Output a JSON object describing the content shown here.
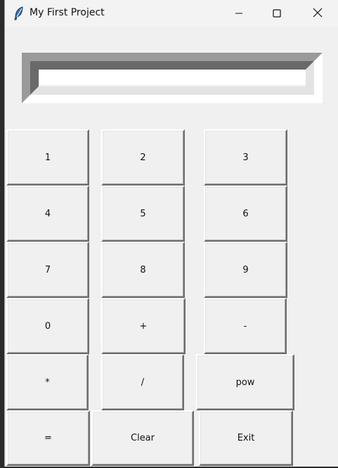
{
  "window": {
    "title": "My First Project"
  },
  "display": {
    "value": ""
  },
  "buttons": {
    "one": "1",
    "two": "2",
    "three": "3",
    "four": "4",
    "five": "5",
    "six": "6",
    "seven": "7",
    "eight": "8",
    "nine": "9",
    "zero": "0",
    "plus": "+",
    "minus": "-",
    "multiply": "*",
    "divide": "/",
    "pow": "pow",
    "equals": "=",
    "clear": "Clear",
    "exit": "Exit"
  }
}
